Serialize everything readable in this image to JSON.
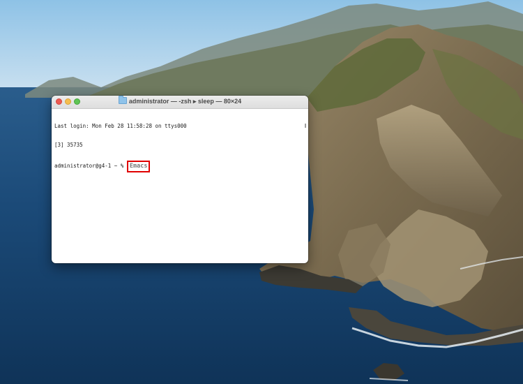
{
  "window": {
    "title": "administrator — -zsh ▸ sleep — 80×24"
  },
  "terminal": {
    "lines": [
      "Last login: Mon Feb 28 11:58:28 on ttys000",
      "[3] 35735"
    ],
    "prompt": "administrator@g4-1 ~ % ",
    "typed_command": "Emacs"
  },
  "icons": {
    "close": "close-icon",
    "minimize": "minimize-icon",
    "zoom": "zoom-icon",
    "folder": "folder-icon"
  },
  "colors": {
    "highlight": "#e00000",
    "close": "#ee5a52",
    "minimize": "#f5be4f",
    "zoom": "#5fc454"
  }
}
